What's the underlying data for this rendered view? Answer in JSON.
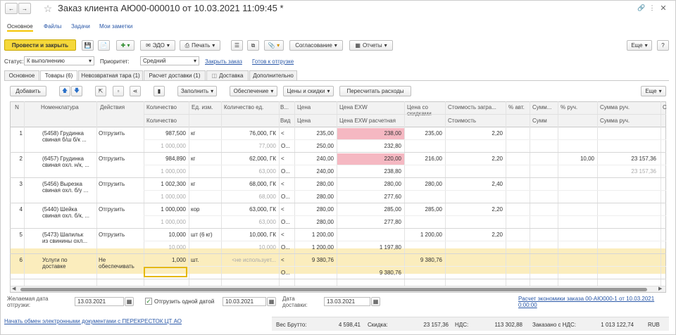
{
  "window": {
    "title": "Заказ клиента АЮ00-000010 от 10.03.2021 11:09:45 *"
  },
  "nav_tabs": [
    "Основное",
    "Файлы",
    "Задачи",
    "Мои заметки"
  ],
  "toolbar": {
    "post_close": "Провести и закрыть",
    "edo": "ЭДО",
    "print": "Печать",
    "approval": "Согласование",
    "reports": "Отчеты",
    "more": "Еще",
    "help": "?"
  },
  "status_row": {
    "status_label": "Статус:",
    "status_value": "К выполнению",
    "priority_label": "Приоритет:",
    "priority_value": "Средний",
    "close_order": "Закрыть заказ",
    "ready_ship": "Готов к отгрузке"
  },
  "tabs": [
    "Основное",
    "Товары (6)",
    "Невозвратная тара (1)",
    "Расчет доставки (1)",
    "Доставка",
    "Дополнительно"
  ],
  "table_toolbar": {
    "add": "Добавить",
    "fill": "Заполнить",
    "provision": "Обеспечение",
    "prices": "Цены и скидки",
    "recalc": "Пересчитать расходы",
    "more": "Еще"
  },
  "headers": {
    "n": "N",
    "nom": "Номенклатура",
    "action": "Действия",
    "qty": "Количество",
    "qty2": "Количество",
    "unit": "Ед. изм.",
    "qtyu": "Количество ед.",
    "v": "В...",
    "vid": "Вид",
    "price": "Цена",
    "price2": "Цена",
    "exw": "Цена EXW",
    "exw2": "Цена EXW расчетная",
    "disc1": "Цена со",
    "disc2": "скидками",
    "cost": "Стоимость загра...",
    "cost2": "Стоимость",
    "pct": "% авт.",
    "sum": "Сумм...",
    "sum2": "Сумм",
    "pctr": "% руч.",
    "sumr": "Сумма руч.",
    "sumr2": "Сумма руч.",
    "c": "С"
  },
  "rows": [
    {
      "n": "1",
      "nom1": "(5458) Грудинка",
      "nom2": "свиная б/ш б/к ...",
      "action": "Отгрузить",
      "qty": "987,500",
      "qty2": "1 000,000",
      "unit": "кг",
      "qtyu": "76,000, ГК",
      "qtyu2": "77,000",
      "v": "<",
      "vid": "О...",
      "price": "235,00",
      "price2": "250,00",
      "exw": "238,00",
      "exw2": "232,80",
      "exw_hl": true,
      "disc": "235,00",
      "cost": "2,20",
      "pctr": "",
      "sumr": "",
      "sumr2": ""
    },
    {
      "n": "2",
      "nom1": "(6457) Грудинка",
      "nom2": "свиная охл. н/к, ...",
      "action": "Отгрузить",
      "qty": "984,890",
      "qty2": "1 000,000",
      "unit": "кг",
      "qtyu": "62,000, ГК",
      "qtyu2": "63,000",
      "v": "<",
      "vid": "О...",
      "price": "240,00",
      "price2": "240,00",
      "exw": "220,00",
      "exw2": "238,80",
      "exw_hl": true,
      "disc": "216,00",
      "cost": "2,20",
      "pctr": "10,00",
      "sumr": "23 157,36",
      "sumr2": "23 157,36"
    },
    {
      "n": "3",
      "nom1": "(5456) Вырезка",
      "nom2": "свиная охл. б/у ...",
      "action": "Отгрузить",
      "qty": "1 002,300",
      "qty2": "1 000,000",
      "unit": "кг",
      "qtyu": "68,000, ГК",
      "qtyu2": "68,000",
      "v": "<",
      "vid": "О...",
      "price": "280,00",
      "price2": "280,00",
      "exw": "280,00",
      "exw2": "277,60",
      "exw_hl": false,
      "disc": "280,00",
      "cost": "2,40",
      "pctr": "",
      "sumr": "",
      "sumr2": ""
    },
    {
      "n": "4",
      "nom1": "(5440) Шейка",
      "nom2": "свиная охл. б/к, ...",
      "action": "Отгрузить",
      "qty": "1 000,000",
      "qty2": "1 000,000",
      "unit": "кор",
      "qtyu": "63,000, ГК",
      "qtyu2": "63,000",
      "v": "<",
      "vid": "О...",
      "price": "280,00",
      "price2": "280,00",
      "exw": "285,00",
      "exw2": "277,80",
      "exw_hl": false,
      "disc": "285,00",
      "cost": "2,20",
      "pctr": "",
      "sumr": "",
      "sumr2": ""
    },
    {
      "n": "5",
      "nom1": "(5473) Шапильк",
      "nom2": "из свинины охл...",
      "action": "Отгрузить",
      "qty": "10,000",
      "qty2": "10,000",
      "unit": "шт (6 кг)",
      "qtyu": "10,000, ГК",
      "qtyu2": "10,000",
      "v": "<",
      "vid": "О...",
      "price": "1 200,00",
      "price2": "1 200,00",
      "exw": "",
      "exw2": "1 197,80",
      "exw_hl": false,
      "disc": "1 200,00",
      "cost": "2,20",
      "pctr": "",
      "sumr": "",
      "sumr2": ""
    },
    {
      "n": "6",
      "nom1": "Услуги по",
      "nom2": "доставке",
      "action": "Не",
      "action2": "обеспечивать",
      "qty": "1,000",
      "qty2": "",
      "unit": "шт.",
      "qtyu": "<не использует...",
      "qtyu2": "",
      "v": "<",
      "vid": "О...",
      "price": "9 380,76",
      "price2": "",
      "exw": "",
      "exw2": "9 380,76",
      "exw_hl": false,
      "disc": "9 380,76",
      "cost": "",
      "pctr": "",
      "sumr": "",
      "sumr2": ""
    }
  ],
  "footer": {
    "desired_label": "Желаемая дата",
    "desired_label2": "отгрузки:",
    "desired_date": "13.03.2021",
    "ship_one": "Отгрузить одной датой",
    "ship_date": "10.03.2021",
    "delivery_label": "Дата",
    "delivery_label2": "доставки:",
    "delivery_date": "13.03.2021",
    "calc_link": "Расчет экономики заказа 00-АЮ000-1 от 10.03.2021",
    "calc_link2": "0:00:00",
    "edo_link": "Начать обмен электронными документами с ПЕРЕКРЕСТОК ЦТ АО"
  },
  "totals": {
    "weight_label": "Вес Брутто:",
    "weight": "4 598,41",
    "discount_label": "Скидка:",
    "discount": "23 157,36",
    "vat_label": "НДС:",
    "vat": "113 302,88",
    "ordered_label": "Заказано с НДС:",
    "ordered": "1 013 122,74",
    "currency": "RUB"
  }
}
